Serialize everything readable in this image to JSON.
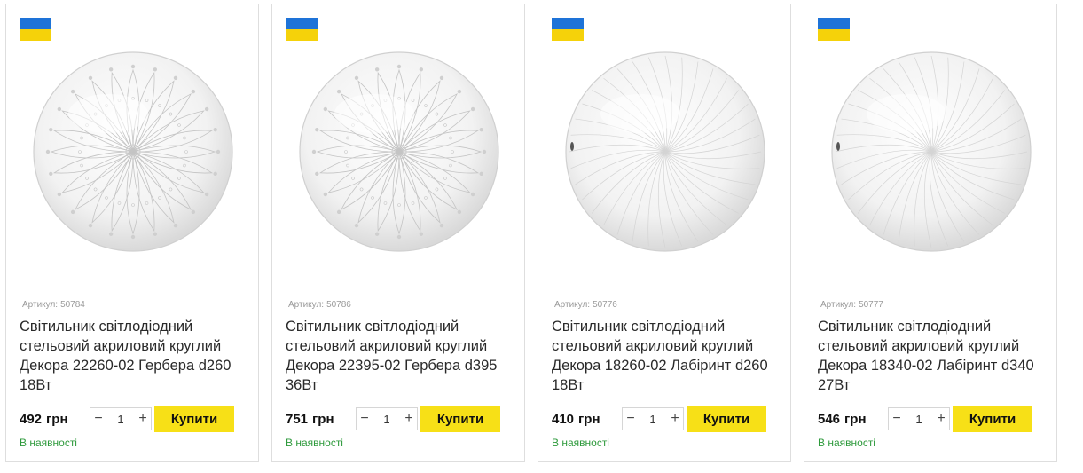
{
  "currency": "грн",
  "sku_label": "Артикул:",
  "buy_label": "Купити",
  "stock_label": "В наявності",
  "colors": {
    "flag_blue": "#1e73d8",
    "flag_yellow": "#f5d20a",
    "buy_button": "#f7e017",
    "in_stock": "#2e9a3c"
  },
  "products": [
    {
      "sku": "50784",
      "title": "Світильник світлодіодний стельовий акриловий круглий Декора 22260-02 Гербера d260 18Вт",
      "price": "492",
      "qty": "1",
      "pattern": "gerbera",
      "badge_icon": "ukraine-flag-icon"
    },
    {
      "sku": "50786",
      "title": "Світильник світлодіодний стельовий акриловий круглий Декора 22395-02 Гербера d395 36Вт",
      "price": "751",
      "qty": "1",
      "pattern": "gerbera",
      "badge_icon": "ukraine-flag-icon"
    },
    {
      "sku": "50776",
      "title": "Світильник світлодіодний стельовий акриловий круглий Декора 18260-02 Лабіринт d260 18Вт",
      "price": "410",
      "qty": "1",
      "pattern": "labyrinth",
      "badge_icon": "ukraine-flag-icon"
    },
    {
      "sku": "50777",
      "title": "Світильник світлодіодний стельовий акриловий круглий Декора 18340-02 Лабіринт d340 27Вт",
      "price": "546",
      "qty": "1",
      "pattern": "labyrinth",
      "badge_icon": "ukraine-flag-icon"
    }
  ]
}
